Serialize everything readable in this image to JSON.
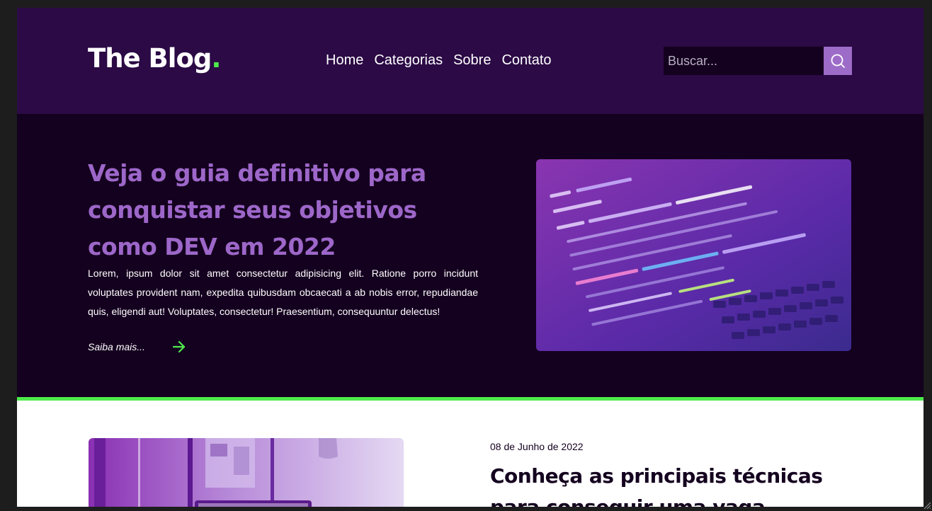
{
  "brand": {
    "name": "The Blog",
    "dot": "."
  },
  "nav": {
    "items": [
      {
        "label": "Home"
      },
      {
        "label": "Categorias"
      },
      {
        "label": "Sobre"
      },
      {
        "label": "Contato"
      }
    ]
  },
  "search": {
    "placeholder": "Buscar...",
    "value": "",
    "icon": "search-icon"
  },
  "hero": {
    "title": "Veja o guia definitivo para conquistar seus objetivos como DEV em 2022",
    "text": "Lorem, ipsum dolor sit amet consectetur adipisicing elit. Ratione porro incidunt voluptates provident nam, expedita quibusdam obcaecati a ab nobis error, repudiandae quis, eligendi aut! Voluptates, consectetur! Praesentium, consequuntur delectus!",
    "read_more": "Saiba mais...",
    "arrow_icon": "arrow-right-icon",
    "image": "code-laptop-image"
  },
  "post": {
    "date": "08 de Junho de 2022",
    "title": "Conheça as principais técnicas para conseguir uma vaga",
    "image": "desk-setup-image"
  },
  "colors": {
    "header_bg": "#2b0a45",
    "hero_bg": "#14001f",
    "accent_purple": "#9d67c9",
    "accent_green": "#4eec4c",
    "button_purple": "#9d6cc8"
  }
}
